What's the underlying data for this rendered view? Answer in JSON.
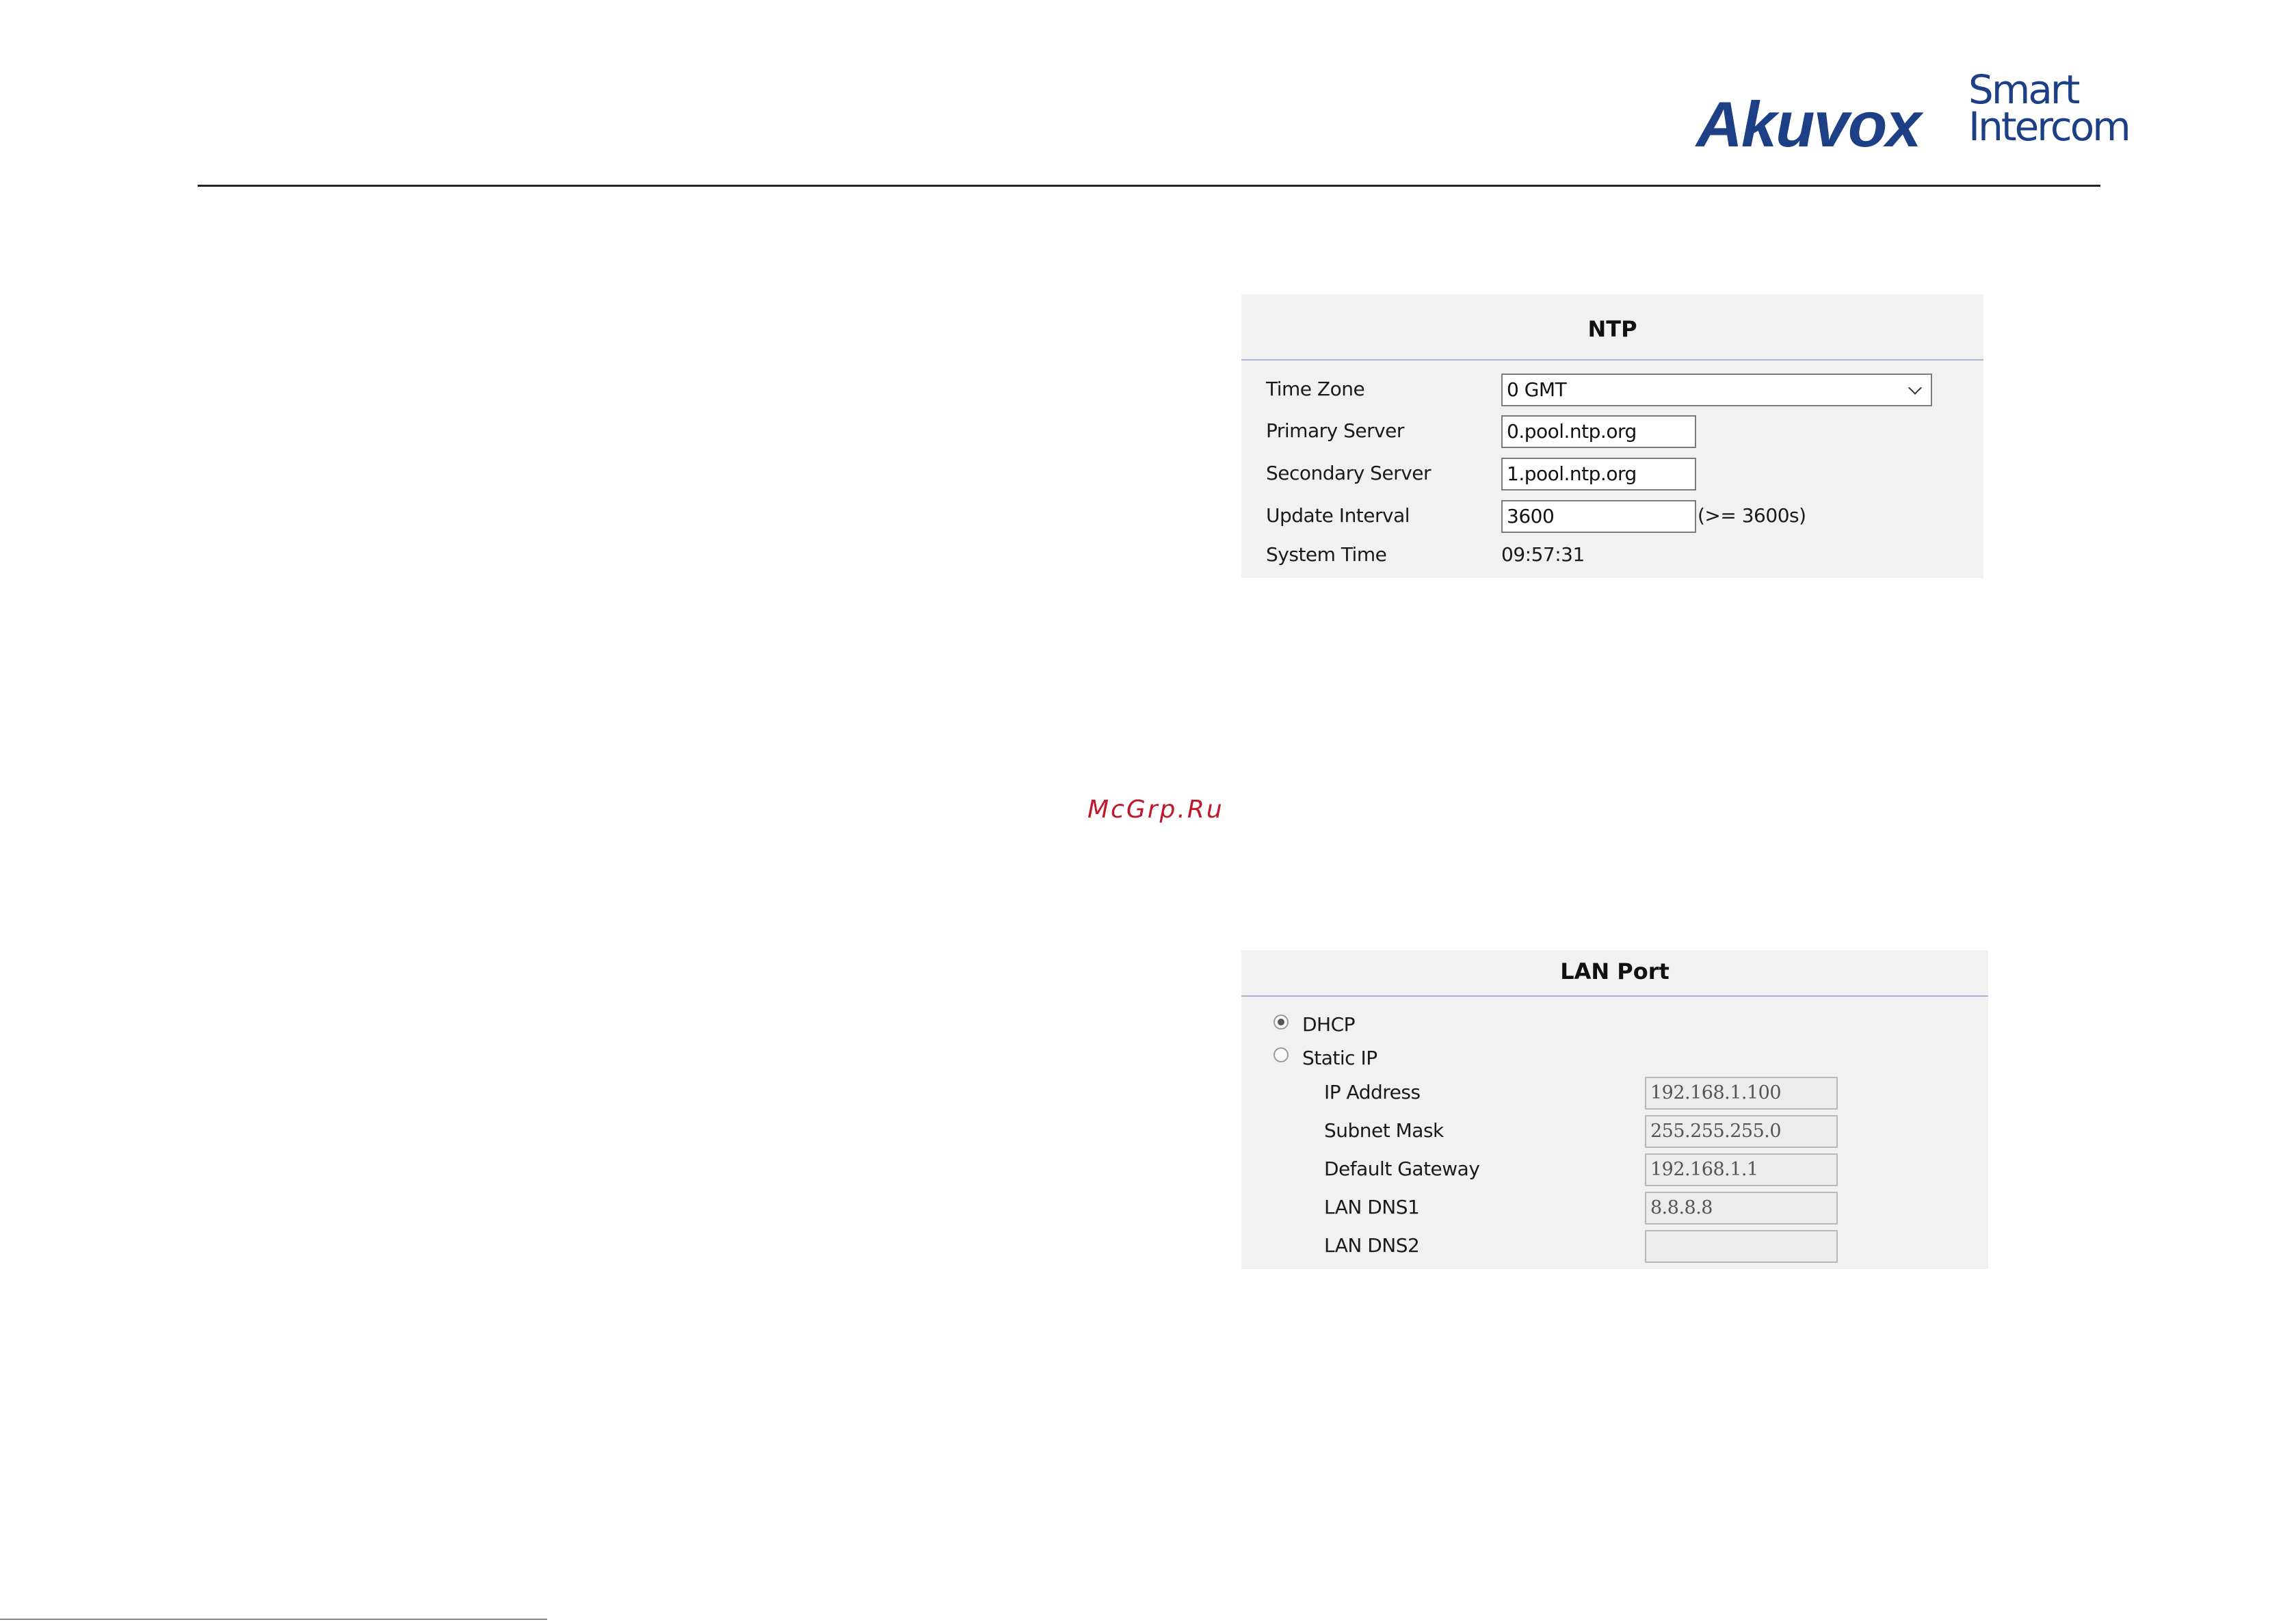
{
  "header": {
    "brand": "Akuvox",
    "tagline_line1": "Smart",
    "tagline_line2": "Intercom"
  },
  "ntp": {
    "title": "NTP",
    "time_zone_label": "Time Zone",
    "time_zone_value": "0 GMT",
    "primary_server_label": "Primary Server",
    "primary_server_value": "0.pool.ntp.org",
    "secondary_server_label": "Secondary Server",
    "secondary_server_value": "1.pool.ntp.org",
    "update_interval_label": "Update Interval",
    "update_interval_value": "3600",
    "update_interval_hint": "(>= 3600s)",
    "system_time_label": "System Time",
    "system_time_value": "09:57:31"
  },
  "watermark": "McGrp.Ru",
  "lan": {
    "title": "LAN Port",
    "dhcp_label": "DHCP",
    "dhcp_selected": true,
    "static_label": "Static IP",
    "static_selected": false,
    "ip_label": "IP Address",
    "ip_value": "192.168.1.100",
    "mask_label": "Subnet Mask",
    "mask_value": "255.255.255.0",
    "gateway_label": "Default Gateway",
    "gateway_value": "192.168.1.1",
    "dns1_label": "LAN DNS1",
    "dns1_value": "8.8.8.8",
    "dns2_label": "LAN DNS2",
    "dns2_value": ""
  },
  "colors": {
    "brand": "#1c3f86",
    "panel_bg": "#f1f1f1",
    "panel_rule": "#a9b6d3",
    "watermark": "#c0182a"
  }
}
